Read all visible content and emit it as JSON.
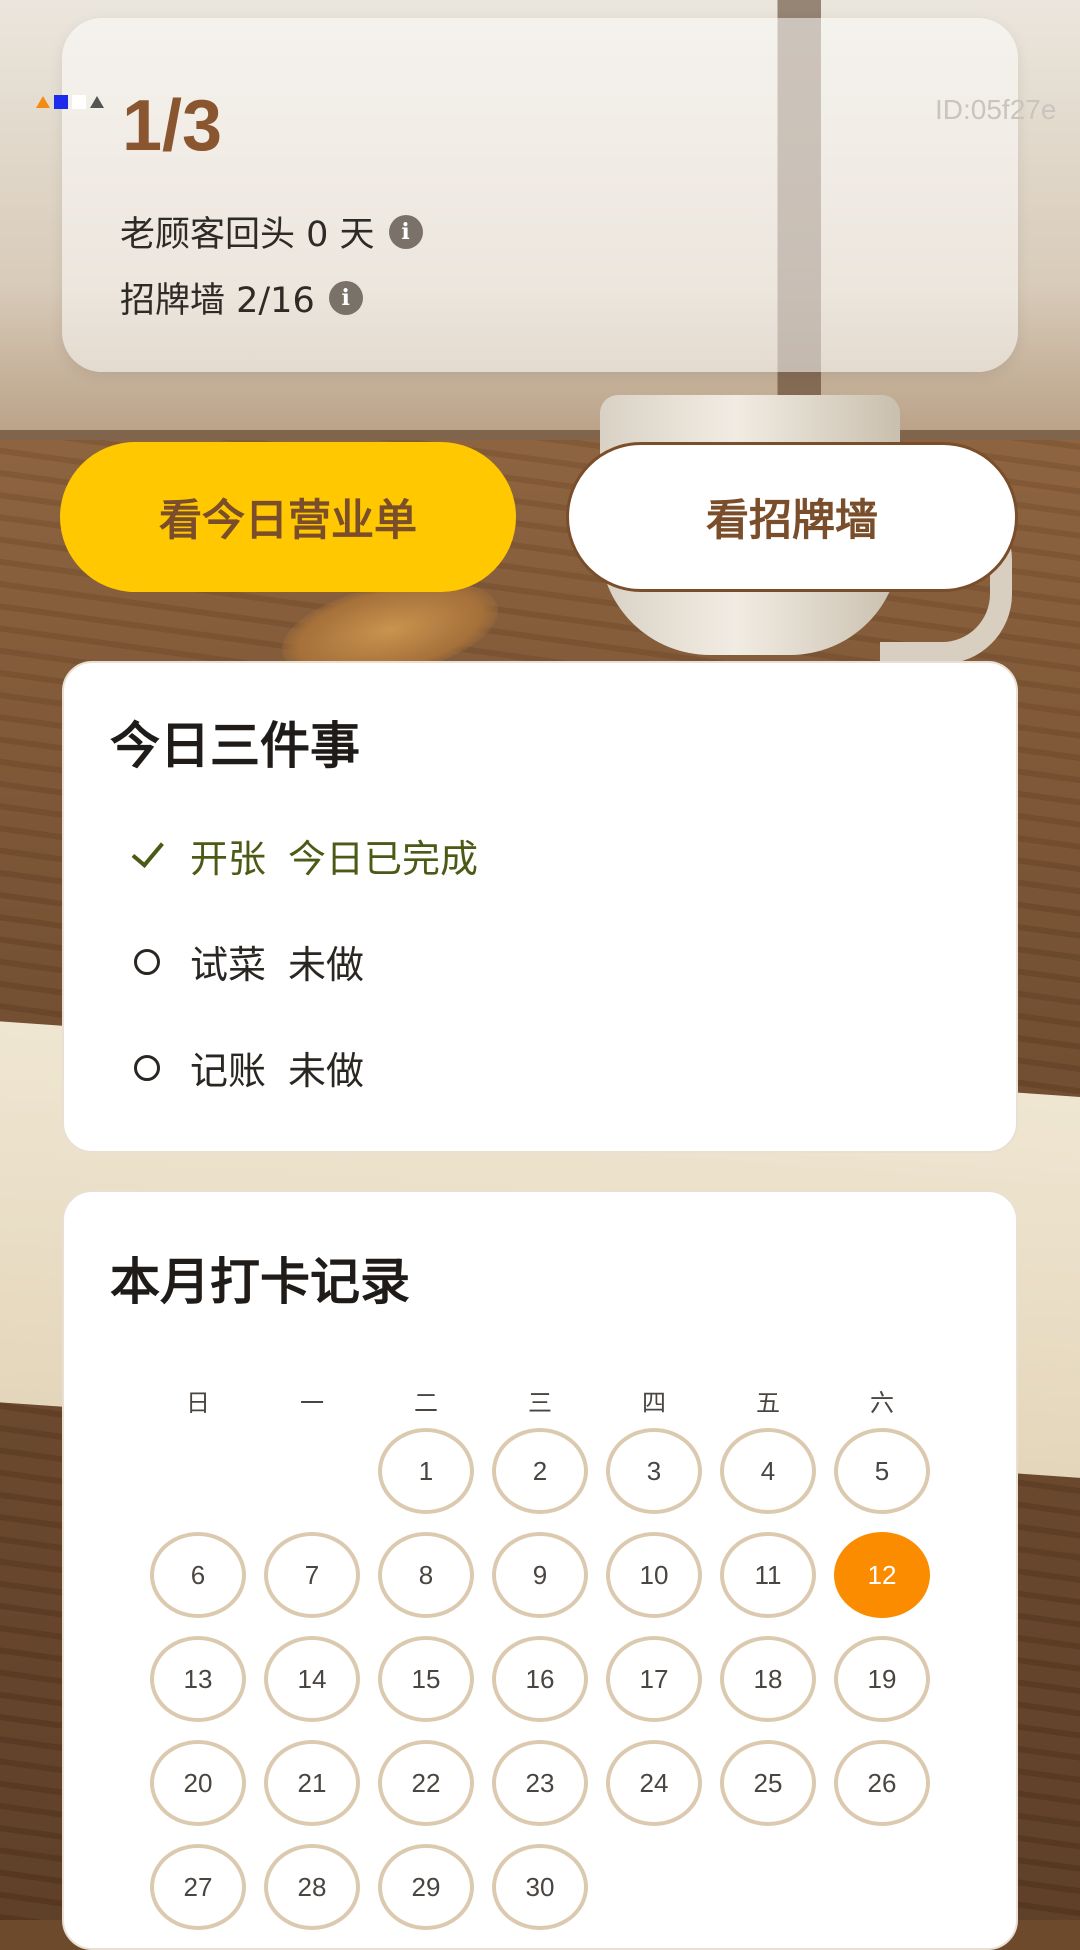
{
  "status": {
    "page_counter": "1/3",
    "record_id": "ID:05f27e",
    "returning_customers": "老顾客回头 0 天",
    "signboard_wall": "招牌墙 2/16"
  },
  "buttons": {
    "today_orders": "看今日营业单",
    "signboard_wall": "看招牌墙"
  },
  "tasks": {
    "title": "今日三件事",
    "items": [
      {
        "name": "开张",
        "status": "今日已完成",
        "done": true
      },
      {
        "name": "试菜",
        "status": "未做",
        "done": false
      },
      {
        "name": "记账",
        "status": "未做",
        "done": false
      }
    ]
  },
  "calendar": {
    "title": "本月打卡记录",
    "weekdays": [
      "日",
      "一",
      "二",
      "三",
      "四",
      "五",
      "六"
    ],
    "first_weekday_index": 2,
    "days_in_month": 30,
    "today": 12,
    "colors": {
      "today": "#fb8c00",
      "ring": "#dccab0"
    }
  },
  "colors": {
    "accent": "#ffc800",
    "brown": "#7a4e2a",
    "done_green": "#4b5a14"
  },
  "icons": [
    "info-icon",
    "check-icon",
    "circle-icon"
  ]
}
